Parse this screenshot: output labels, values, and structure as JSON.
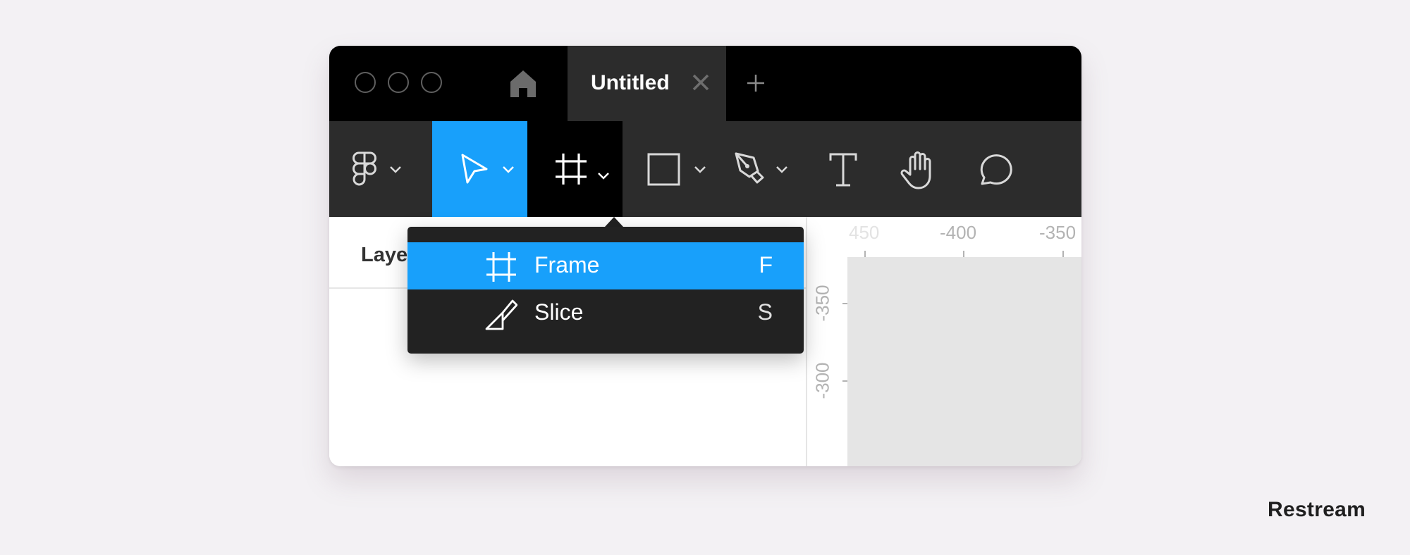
{
  "window": {
    "traffic_lights": [
      "close",
      "minimize",
      "maximize"
    ],
    "home_icon": "home-icon",
    "tabs": [
      {
        "label": "Untitled",
        "active": true,
        "close_icon": "close-icon"
      }
    ],
    "new_tab_icon": "plus-icon"
  },
  "toolbar": {
    "tools": [
      {
        "name": "Main menu",
        "icon": "figma-logo-icon",
        "has_dropdown": true,
        "state": "default"
      },
      {
        "name": "Move",
        "icon": "cursor-arrow-icon",
        "has_dropdown": true,
        "state": "selected"
      },
      {
        "name": "Frame",
        "icon": "frame-icon",
        "has_dropdown": true,
        "state": "open"
      },
      {
        "name": "Rectangle",
        "icon": "rectangle-icon",
        "has_dropdown": true,
        "state": "default"
      },
      {
        "name": "Pen",
        "icon": "pen-icon",
        "has_dropdown": true,
        "state": "default"
      },
      {
        "name": "Text",
        "icon": "text-icon",
        "has_dropdown": false,
        "state": "default"
      },
      {
        "name": "Hand",
        "icon": "hand-icon",
        "has_dropdown": false,
        "state": "default"
      },
      {
        "name": "Comment",
        "icon": "comment-icon",
        "has_dropdown": false,
        "state": "default"
      }
    ]
  },
  "frame_menu": {
    "items": [
      {
        "label": "Frame",
        "shortcut": "F",
        "icon": "frame-icon",
        "highlighted": true
      },
      {
        "label": "Slice",
        "shortcut": "S",
        "icon": "slice-icon",
        "highlighted": false
      }
    ]
  },
  "left_panel": {
    "title": "Layers"
  },
  "rulers": {
    "horizontal": [
      "-450",
      "-400",
      "-350"
    ],
    "horizontal_visible": [
      "450",
      "-400",
      "-350"
    ],
    "vertical": [
      "-350",
      "-300"
    ]
  },
  "colors": {
    "accent": "#18a0fb",
    "titlebar": "#000000",
    "toolbar": "#2c2c2c",
    "menu": "#222222",
    "canvas": "#e5e5e5",
    "page_bg": "#f3f1f4"
  },
  "watermark": "Restream"
}
